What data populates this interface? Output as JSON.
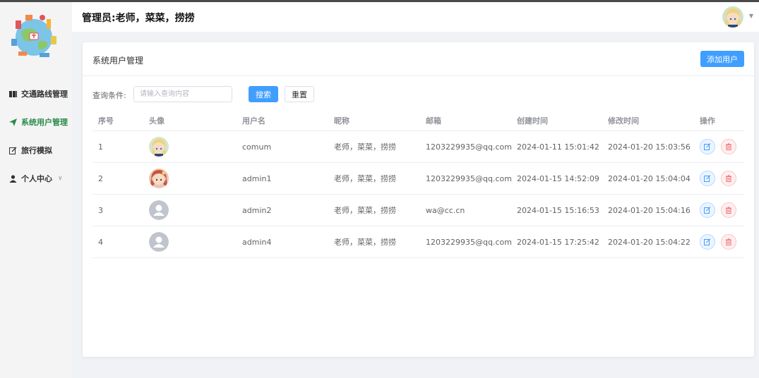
{
  "header": {
    "title": "管理员:老师，菜菜，捞捞"
  },
  "sidebar": {
    "items": [
      {
        "label": "交通路线管理",
        "icon": "book-icon"
      },
      {
        "label": "系统用户管理",
        "icon": "send-icon",
        "active": true
      },
      {
        "label": "旅行模拟",
        "icon": "edit-icon"
      },
      {
        "label": "个人中心",
        "icon": "user-icon"
      }
    ]
  },
  "card": {
    "title": "系统用户管理",
    "add_label": "添加用户"
  },
  "search": {
    "label": "查询条件:",
    "placeholder": "请输入查询内容",
    "search_label": "搜索",
    "reset_label": "重置"
  },
  "table": {
    "columns": [
      "序号",
      "头像",
      "用户名",
      "昵称",
      "邮箱",
      "创建时间",
      "修改时间",
      "操作"
    ],
    "rows": [
      {
        "index": "1",
        "avatar": "anime-blonde",
        "username": "comum",
        "nickname": "老师，菜菜，捞捞",
        "email": "1203229935@qq.com",
        "created": "2024-01-11 15:01:42",
        "updated": "2024-01-20 15:03:56"
      },
      {
        "index": "2",
        "avatar": "anime-redhead",
        "username": "admin1",
        "nickname": "老师，菜菜，捞捞",
        "email": "1203229935@qq.com",
        "created": "2024-01-15 14:52:09",
        "updated": "2024-01-20 15:04:04"
      },
      {
        "index": "3",
        "avatar": "default-user",
        "username": "admin2",
        "nickname": "老师，菜菜，捞捞",
        "email": "wa@cc.cn",
        "created": "2024-01-15 15:16:53",
        "updated": "2024-01-20 15:04:16"
      },
      {
        "index": "4",
        "avatar": "default-user",
        "username": "admin4",
        "nickname": "老师，菜菜，捞捞",
        "email": "1203229935@qq.com",
        "created": "2024-01-15 17:25:42",
        "updated": "2024-01-20 15:04:22"
      }
    ]
  },
  "colors": {
    "primary": "#409eff",
    "active_menu": "#2a8a4a",
    "danger": "#f56c6c"
  }
}
